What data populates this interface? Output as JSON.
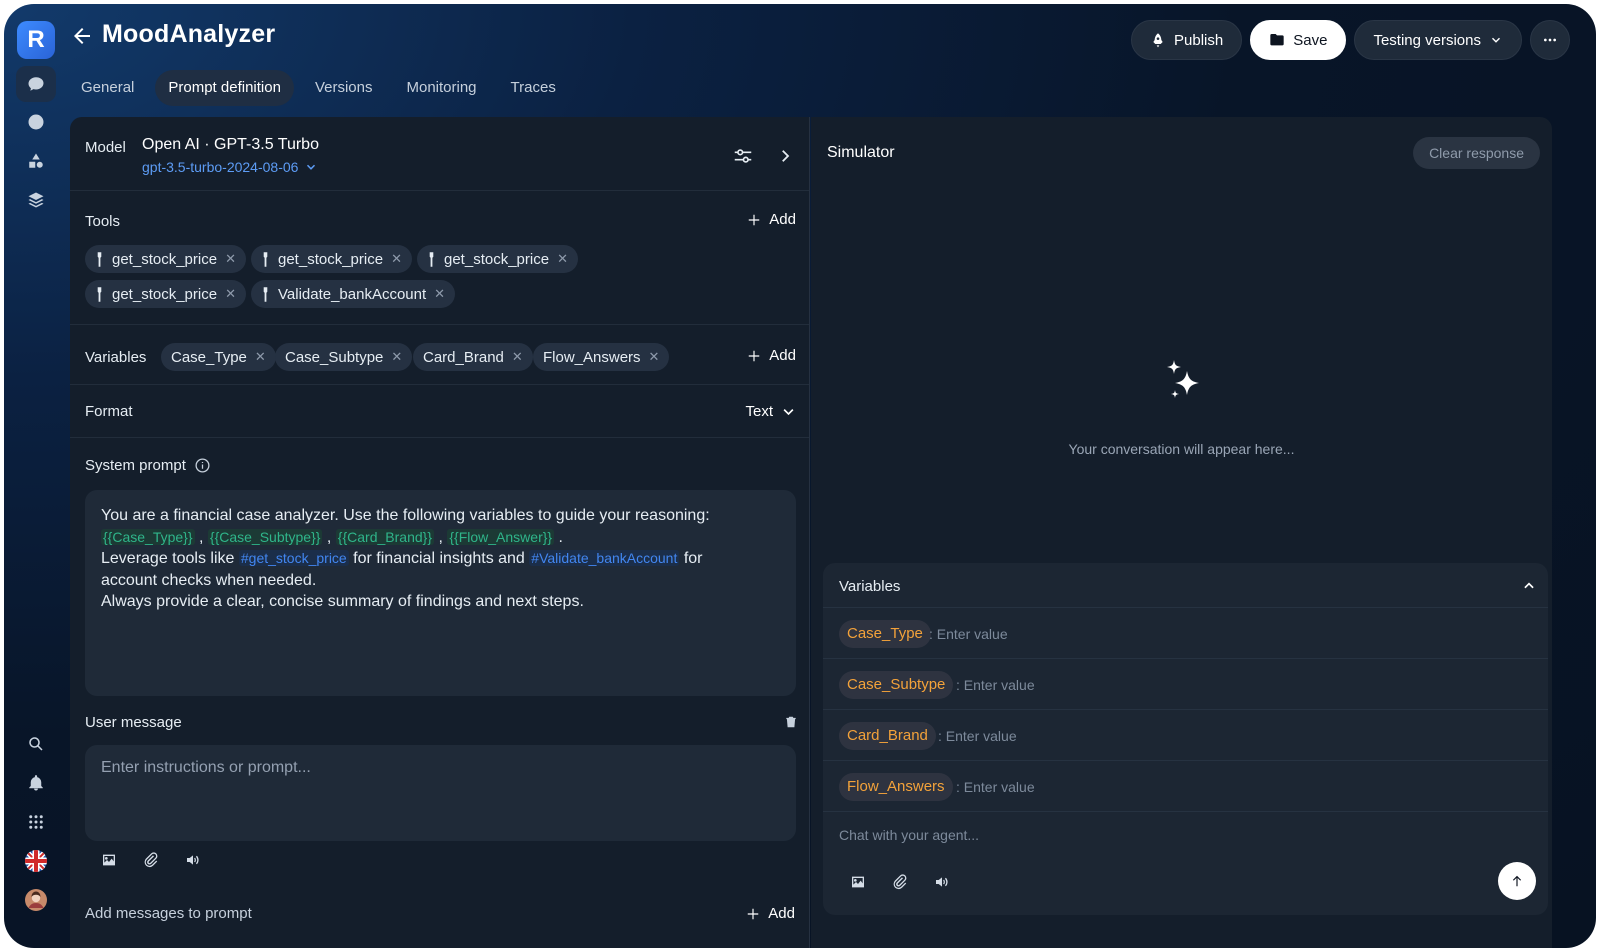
{
  "app": {
    "logo_letter": "R",
    "title": "MoodAnalyzer"
  },
  "header": {
    "publish_label": "Publish",
    "save_label": "Save",
    "versions_label": "Testing versions"
  },
  "tabs": [
    {
      "label": "General"
    },
    {
      "label": "Prompt definition"
    },
    {
      "label": "Versions"
    },
    {
      "label": "Monitoring"
    },
    {
      "label": "Traces"
    }
  ],
  "model": {
    "label": "Model",
    "name": "Open AI · GPT-3.5 Turbo",
    "version": "gpt-3.5-turbo-2024-08-06"
  },
  "tools": {
    "label": "Tools",
    "add_label": "Add",
    "items": [
      "get_stock_price",
      "get_stock_price",
      "get_stock_price",
      "get_stock_price",
      "Validate_bankAccount"
    ]
  },
  "variables": {
    "label": "Variables",
    "add_label": "Add",
    "items": [
      "Case_Type",
      "Case_Subtype",
      "Card_Brand",
      "Flow_Answers"
    ]
  },
  "format": {
    "label": "Format",
    "value": "Text"
  },
  "system_prompt": {
    "label": "System prompt",
    "line1": "You are a financial case analyzer. Use the following variables to guide your reasoning:",
    "var1": "{{Case_Type}}",
    "var2": "{{Case_Subtype}}",
    "var3": "{{Card_Brand}}",
    "var4": "{{Flow_Answer}}",
    "sep": ",",
    "end": ".",
    "line2_a": "Leverage tools like",
    "tool1": "#get_stock_price",
    "line2_b": "for financial insights and",
    "tool2": "#Validate_bankAccount",
    "line2_c": "for",
    "line3": "account checks when needed.",
    "line4": "Always provide a clear, concise summary of findings and next steps."
  },
  "user_message": {
    "label": "User message",
    "placeholder": "Enter instructions or prompt..."
  },
  "add_messages": {
    "label": "Add messages to prompt",
    "add_label": "Add"
  },
  "simulator": {
    "title": "Simulator",
    "clear_label": "Clear response",
    "empty_text": "Your conversation will appear here...",
    "variables_label": "Variables",
    "rows": [
      {
        "name": "Case_Type",
        "placeholder": ": Enter value"
      },
      {
        "name": "Case_Subtype",
        "placeholder": ": Enter value"
      },
      {
        "name": "Card_Brand",
        "placeholder": ": Enter value"
      },
      {
        "name": "Flow_Answers",
        "placeholder": ": Enter value"
      }
    ],
    "chat_placeholder": "Chat with your agent..."
  },
  "colors": {
    "accent_blue": "#5d9cf5",
    "variable_green": "#2fb58a",
    "variable_orange": "#f3a23a"
  }
}
